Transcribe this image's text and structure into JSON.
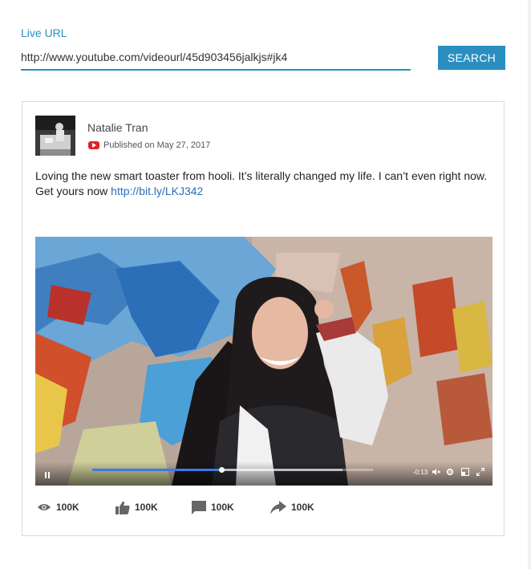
{
  "search": {
    "label": "Live URL",
    "url_value": "http://www.youtube.com/videourl/45d903456jalkjs#jk4",
    "button_label": "SEARCH"
  },
  "post": {
    "author": "Natalie Tran",
    "published": "Published on May 27, 2017",
    "platform_icon": "youtube-icon",
    "text": "Loving the new smart toaster from hooli. It’s literally changed my life. I can’t even right now. Get yours now ",
    "link_text": "http://bit.ly/LKJ342"
  },
  "video": {
    "time_remaining": "-0:13",
    "progress_fraction": 0.46,
    "buffered_fraction": 0.89,
    "controls": [
      "pause-icon",
      "mute-icon",
      "settings-icon",
      "pip-icon",
      "fullscreen-icon"
    ]
  },
  "stats": {
    "views": {
      "icon": "eye-icon",
      "value": "100K"
    },
    "likes": {
      "icon": "thumbs-up-icon",
      "value": "100K"
    },
    "comments": {
      "icon": "comment-icon",
      "value": "100K"
    },
    "shares": {
      "icon": "share-icon",
      "value": "100K"
    }
  },
  "colors": {
    "accent": "#2a8fc0",
    "link": "#2a6ebb",
    "youtube_red": "#d9252b",
    "progress": "#3b7be4"
  }
}
